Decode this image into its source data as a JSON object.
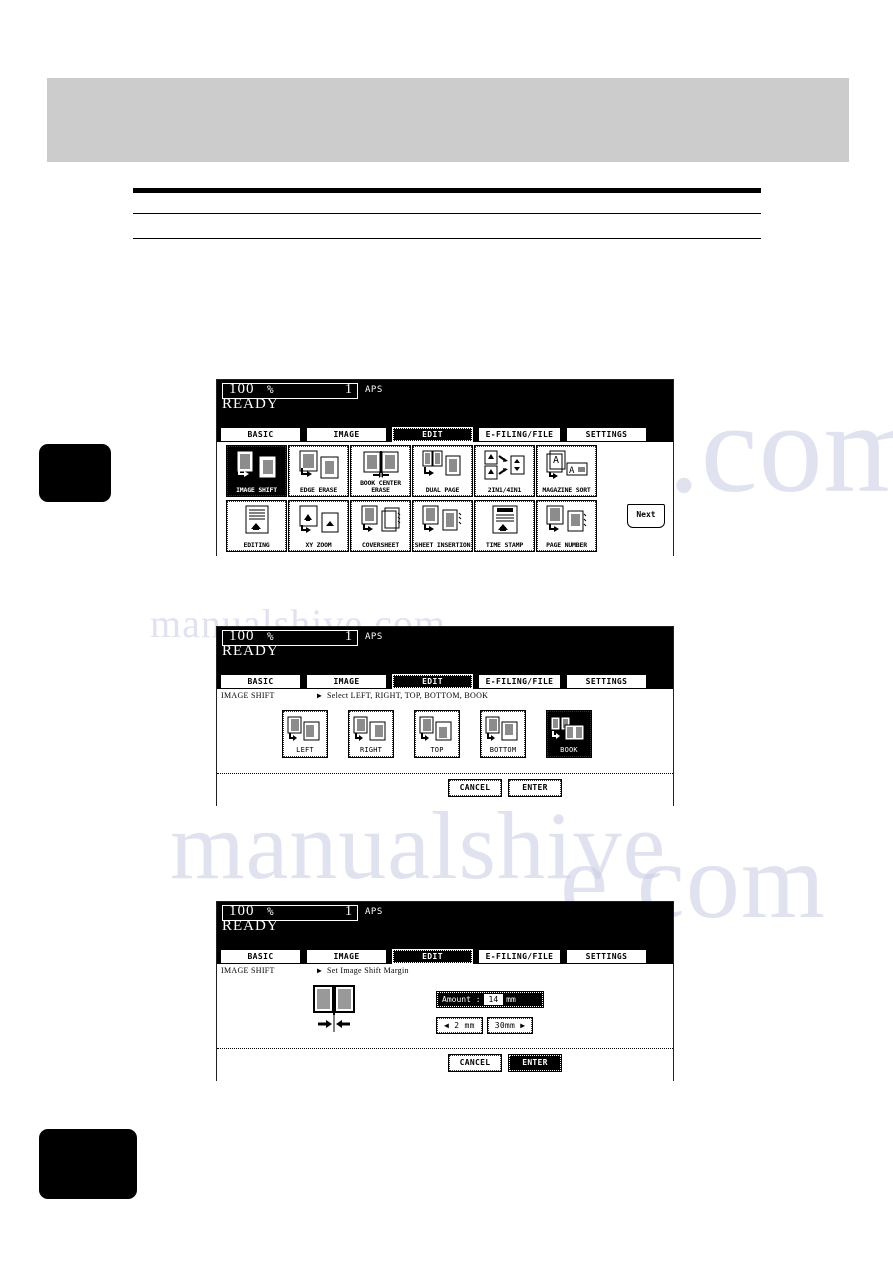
{
  "page": {
    "background_color": "#ffffff",
    "header_band_color": "#cccccc",
    "tab_color": "#000000",
    "watermark_text_1": "manualshive.com",
    "watermark_text_2": "manualshive",
    "watermark_text_3": "e.com",
    "watermark_text_4": "manualshive.com"
  },
  "panels": [
    {
      "id": "panel-1",
      "status": {
        "ratio": "100",
        "percent": "%",
        "copies": "1",
        "paper_mode": "APS",
        "state": "READY"
      },
      "tabs": [
        {
          "label": "BASIC",
          "selected": false
        },
        {
          "label": "IMAGE",
          "selected": false
        },
        {
          "label": "EDIT",
          "selected": true
        },
        {
          "label": "E-FILING/FILE",
          "selected": false
        },
        {
          "label": "SETTINGS",
          "selected": false
        }
      ],
      "functions": [
        {
          "label": "IMAGE SHIFT",
          "icon": "image-shift-icon",
          "selected": true
        },
        {
          "label": "EDGE ERASE",
          "icon": "edge-erase-icon",
          "selected": false
        },
        {
          "label": "BOOK CENTER ERASE",
          "icon": "book-center-erase-icon",
          "selected": false
        },
        {
          "label": "DUAL PAGE",
          "icon": "dual-page-icon",
          "selected": false
        },
        {
          "label": "2IN1/4IN1",
          "icon": "2in1-4in1-icon",
          "selected": false
        },
        {
          "label": "MAGAZINE SORT",
          "icon": "magazine-sort-icon",
          "selected": false
        },
        {
          "label": "EDITING",
          "icon": "editing-icon",
          "selected": false
        },
        {
          "label": "XY ZOOM",
          "icon": "xy-zoom-icon",
          "selected": false
        },
        {
          "label": "COVERSHEET",
          "icon": "coversheet-icon",
          "selected": false
        },
        {
          "label": "SHEET INSERTION",
          "icon": "sheet-insertion-icon",
          "selected": false
        },
        {
          "label": "TIME STAMP",
          "icon": "time-stamp-icon",
          "selected": false
        },
        {
          "label": "PAGE NUMBER",
          "icon": "page-number-icon",
          "selected": false
        }
      ],
      "next_label": "Next"
    },
    {
      "id": "panel-2",
      "status": {
        "ratio": "100",
        "percent": "%",
        "copies": "1",
        "paper_mode": "APS",
        "state": "READY"
      },
      "tabs": [
        {
          "label": "BASIC",
          "selected": false
        },
        {
          "label": "IMAGE",
          "selected": false
        },
        {
          "label": "EDIT",
          "selected": true
        },
        {
          "label": "E-FILING/FILE",
          "selected": false
        },
        {
          "label": "SETTINGS",
          "selected": false
        }
      ],
      "breadcrumb": "IMAGE SHIFT",
      "breadcrumb_arrow": "▶",
      "instruction": "Select LEFT, RIGHT, TOP, BOTTOM, BOOK",
      "options": [
        {
          "label": "LEFT",
          "icon": "shift-left-icon",
          "selected": false
        },
        {
          "label": "RIGHT",
          "icon": "shift-right-icon",
          "selected": false
        },
        {
          "label": "TOP",
          "icon": "shift-top-icon",
          "selected": false
        },
        {
          "label": "BOTTOM",
          "icon": "shift-bottom-icon",
          "selected": false
        },
        {
          "label": "BOOK",
          "icon": "shift-book-icon",
          "selected": true
        }
      ],
      "footer": [
        {
          "label": "CANCEL",
          "selected": false
        },
        {
          "label": "ENTER",
          "selected": false
        }
      ]
    },
    {
      "id": "panel-3",
      "status": {
        "ratio": "100",
        "percent": "%",
        "copies": "1",
        "paper_mode": "APS",
        "state": "READY"
      },
      "tabs": [
        {
          "label": "BASIC",
          "selected": false
        },
        {
          "label": "IMAGE",
          "selected": false
        },
        {
          "label": "EDIT",
          "selected": true
        },
        {
          "label": "E-FILING/FILE",
          "selected": false
        },
        {
          "label": "SETTINGS",
          "selected": false
        }
      ],
      "breadcrumb": "IMAGE SHIFT",
      "breadcrumb_arrow": "▶",
      "instruction": "Set Image Shift Margin",
      "amount": {
        "label": "Amount :",
        "value": "14",
        "unit": "mm"
      },
      "steppers": [
        {
          "label": "◀ 2 mm",
          "name": "decrease-margin-button"
        },
        {
          "label": "30mm ▶",
          "name": "increase-margin-button"
        }
      ],
      "footer": [
        {
          "label": "CANCEL",
          "selected": false
        },
        {
          "label": "ENTER",
          "selected": true
        }
      ]
    }
  ]
}
